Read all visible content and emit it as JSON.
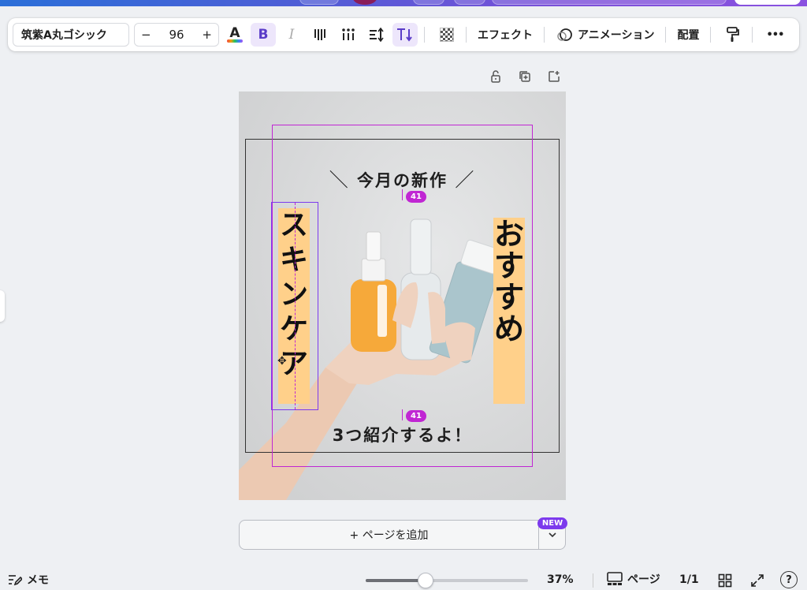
{
  "toolbar": {
    "font_family": "筑紫A丸ゴシック",
    "font_size": "96",
    "decrease_label": "−",
    "increase_label": "+",
    "text_color_label": "A",
    "bold_label": "B",
    "italic_label": "I",
    "effects_label": "エフェクト",
    "animation_label": "アニメーション",
    "position_label": "配置",
    "more_label": "•••"
  },
  "design": {
    "headline_left": "＼",
    "headline_text": "今月の新作",
    "headline_right": "／",
    "left_vertical": [
      "ス",
      "キ",
      "ン",
      "ケ",
      "ア"
    ],
    "right_vertical": [
      "お",
      "す",
      "す",
      "め"
    ],
    "bottom_text": "3つ紹介するよ！",
    "spacing_badge_top": "41",
    "spacing_badge_bottom": "41"
  },
  "add_page": {
    "label": "+ ページを追加",
    "new_badge": "NEW"
  },
  "footer": {
    "memo_label": "メモ",
    "zoom_level": "37%",
    "zoom_fraction": 0.37,
    "pages_label": "ページ",
    "page_count": "1/1",
    "help_label": "?"
  },
  "colors": {
    "accent_purple": "#7c3aed",
    "guide_magenta": "#c026d3",
    "highlight_orange": "#ffd08a"
  },
  "icons": [
    "lock-icon",
    "duplicate-icon",
    "add-page-icon",
    "paint-roller-icon",
    "grid-view-icon",
    "fullscreen-icon",
    "notes-icon"
  ]
}
